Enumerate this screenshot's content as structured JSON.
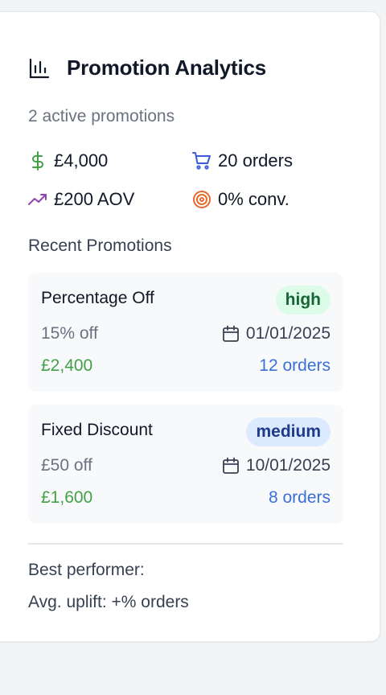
{
  "header": {
    "title": "Promotion Analytics",
    "subtitle": "2 active promotions",
    "icon": "bar-chart-icon"
  },
  "stats": {
    "revenue": {
      "value": "£4,000",
      "icon": "dollar-icon",
      "color": "#43a047"
    },
    "orders": {
      "value": "20 orders",
      "icon": "cart-icon",
      "color": "#3b5bdb"
    },
    "aov": {
      "value": "£200 AOV",
      "icon": "trending-up-icon",
      "color": "#8e44ad"
    },
    "conversion": {
      "value": "0% conv.",
      "icon": "target-icon",
      "color": "#e8692d"
    }
  },
  "recent": {
    "label": "Recent Promotions",
    "items": [
      {
        "name": "Percentage Off",
        "badge": "high",
        "discount": "15% off",
        "date": "01/01/2025",
        "revenue": "£2,400",
        "orders": "12 orders"
      },
      {
        "name": "Fixed Discount",
        "badge": "medium",
        "discount": "£50 off",
        "date": "10/01/2025",
        "revenue": "£1,600",
        "orders": "8 orders"
      }
    ]
  },
  "footer": {
    "best_performer": "Best performer:",
    "avg_uplift_label": "Avg. uplift:",
    "avg_uplift_value": "+% orders"
  },
  "colors": {
    "green": "#43a047",
    "blue": "#3b6fd8",
    "high_badge_bg": "#dcfce7",
    "medium_badge_bg": "#dbeafe"
  }
}
